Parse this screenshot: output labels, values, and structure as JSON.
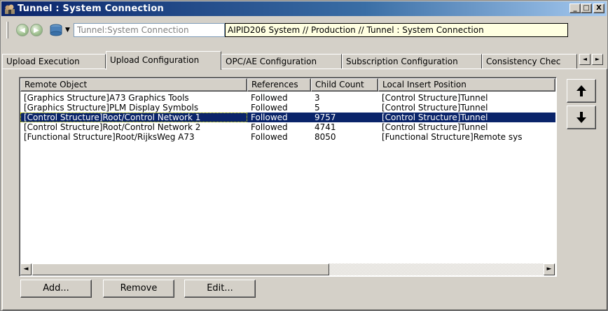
{
  "window": {
    "title": "Tunnel : System Connection",
    "controls": {
      "minimize": "_",
      "maximize": "□",
      "close": "X"
    }
  },
  "addressbar": {
    "path": "Tunnel:System Connection",
    "full_path_tooltip": "AIPID206 System // Production // Tunnel : System Connection",
    "icons": {
      "back": "back-arrow-icon",
      "forward": "forward-arrow-icon",
      "location": "database-icon",
      "dropdown": "chevron-down-icon"
    }
  },
  "tabs": [
    {
      "label": "Upload Execution",
      "active": false
    },
    {
      "label": "Upload Configuration",
      "active": true
    },
    {
      "label": "OPC/AE Configuration",
      "active": false
    },
    {
      "label": "Subscription Configuration",
      "active": false
    },
    {
      "label": "Consistency Chec",
      "active": false
    }
  ],
  "tab_scroll": {
    "left": "◄",
    "right": "►"
  },
  "listview": {
    "columns": [
      "Remote Object",
      "References",
      "Child Count",
      "Local Insert Position"
    ],
    "rows": [
      {
        "remote_object": "[Graphics Structure]A73 Graphics Tools",
        "references": "Followed",
        "child_count": "3",
        "local_insert_position": "[Control Structure]Tunnel",
        "selected": false
      },
      {
        "remote_object": "[Graphics Structure]PLM Display Symbols",
        "references": "Followed",
        "child_count": "5",
        "local_insert_position": "[Control Structure]Tunnel",
        "selected": false
      },
      {
        "remote_object": "[Control Structure]Root/Control Network 1",
        "references": "Followed",
        "child_count": "9757",
        "local_insert_position": "[Control Structure]Tunnel",
        "selected": true
      },
      {
        "remote_object": "[Control Structure]Root/Control Network 2",
        "references": "Followed",
        "child_count": "4741",
        "local_insert_position": "[Control Structure]Tunnel",
        "selected": false
      },
      {
        "remote_object": "[Functional Structure]Root/RijksWeg A73",
        "references": "Followed",
        "child_count": "8050",
        "local_insert_position": "[Functional Structure]Remote sys",
        "selected": false
      }
    ],
    "scroll_left": "◄",
    "scroll_right": "►"
  },
  "side_buttons": {
    "up": "arrow-up-icon",
    "down": "arrow-down-icon"
  },
  "buttons": {
    "add": "Add...",
    "remove": "Remove",
    "edit": "Edit..."
  },
  "colors": {
    "title_active": "#0a246a",
    "selection": "#0a246a",
    "face": "#d4d0c8"
  }
}
